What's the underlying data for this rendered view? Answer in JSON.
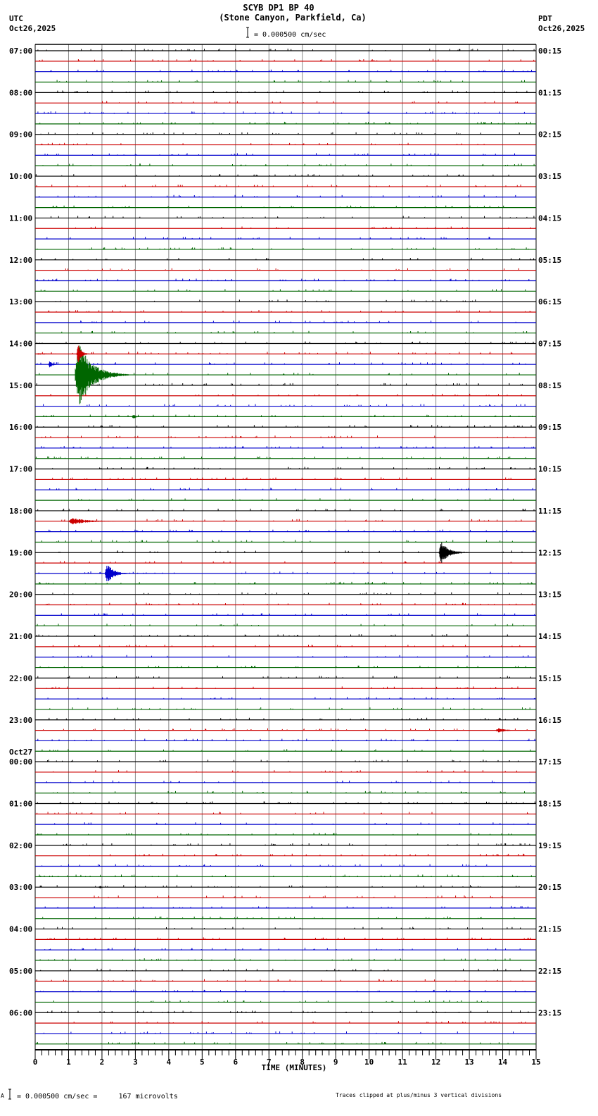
{
  "header": {
    "title": "SCYB DP1 BP 40",
    "subtitle": "(Stone Canyon, Parkfield, Ca)",
    "left_tz": "UTC",
    "left_date": "Oct26,2025",
    "right_tz": "PDT",
    "right_date": "Oct26,2025",
    "scale_text": "= 0.000500 cm/sec"
  },
  "footer": {
    "scale_text": "= 0.000500 cm/sec =     167 microvolts",
    "clip_note": "Traces clipped at plus/minus 3 vertical divisions",
    "corner_mark": "A"
  },
  "chart_data": {
    "type": "line",
    "title": "SCYB DP1 BP 40",
    "xlabel": "TIME (MINUTES)",
    "xlim": [
      0,
      15
    ],
    "x_ticks": [
      "0",
      "1",
      "2",
      "3",
      "4",
      "5",
      "6",
      "7",
      "8",
      "9",
      "10",
      "11",
      "12",
      "13",
      "14",
      "15"
    ],
    "traces_per_hour": 4,
    "trace_colors": [
      "#000000",
      "#cc0000",
      "#0000cc",
      "#006600"
    ],
    "date_change_label": "Oct27",
    "left_labels": [
      "07:00",
      "08:00",
      "09:00",
      "10:00",
      "11:00",
      "12:00",
      "13:00",
      "14:00",
      "15:00",
      "16:00",
      "17:00",
      "18:00",
      "19:00",
      "20:00",
      "21:00",
      "22:00",
      "23:00",
      "00:00",
      "01:00",
      "02:00",
      "03:00",
      "04:00",
      "05:00",
      "06:00"
    ],
    "right_labels": [
      "00:15",
      "01:15",
      "02:15",
      "03:15",
      "04:15",
      "05:15",
      "06:15",
      "07:15",
      "08:15",
      "09:15",
      "10:15",
      "11:15",
      "12:15",
      "13:15",
      "14:15",
      "15:15",
      "16:15",
      "17:15",
      "18:15",
      "19:15",
      "20:15",
      "21:15",
      "22:15",
      "23:15"
    ],
    "events": [
      {
        "trace": 30,
        "start_min": 0.4,
        "duration_min": 0.4,
        "amplitude": 0.3
      },
      {
        "trace": 31,
        "start_min": 1.2,
        "duration_min": 1.6,
        "amplitude": 3.0
      },
      {
        "trace": 29,
        "start_min": 1.25,
        "duration_min": 0.4,
        "amplitude": 1.0
      },
      {
        "trace": 35,
        "start_min": 2.9,
        "duration_min": 0.4,
        "amplitude": 0.2
      },
      {
        "trace": 45,
        "start_min": 1.0,
        "duration_min": 1.8,
        "amplitude": 0.3
      },
      {
        "trace": 48,
        "start_min": 12.1,
        "duration_min": 0.9,
        "amplitude": 1.0
      },
      {
        "trace": 50,
        "start_min": 2.1,
        "duration_min": 0.8,
        "amplitude": 0.9
      },
      {
        "trace": 65,
        "start_min": 13.8,
        "duration_min": 1.0,
        "amplitude": 0.2
      },
      {
        "trace": 80,
        "start_min": 1.9,
        "duration_min": 0.3,
        "amplitude": 0.15
      },
      {
        "trace": 29,
        "start_min": 0.0,
        "duration_min": 1.9,
        "amplitude": 0.08
      }
    ]
  }
}
